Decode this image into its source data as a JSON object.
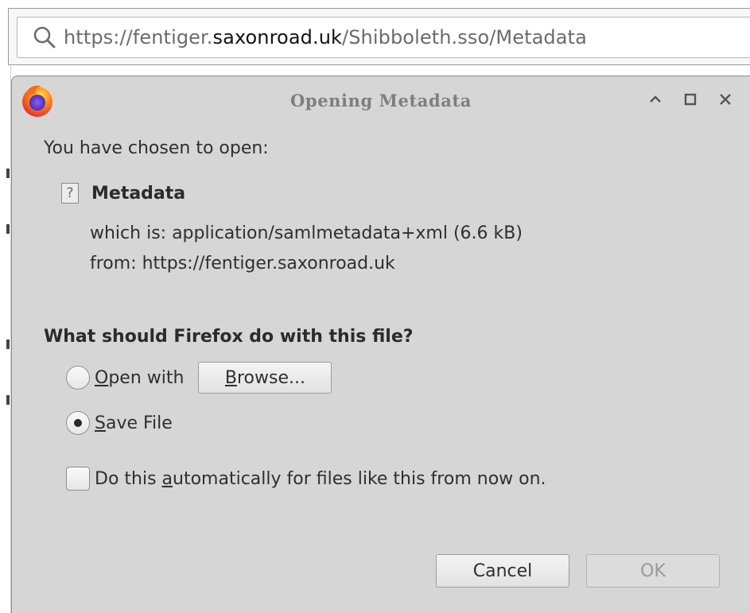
{
  "urlbar": {
    "prefix": "https://fentiger.",
    "domain": "saxonroad.uk",
    "path": "/Shibboleth.sso/Metadata",
    "search_icon": "search-icon"
  },
  "dialog": {
    "title": "Opening Metadata",
    "app_icon": "firefox-logo",
    "controls": [
      "minimize-icon",
      "maximize-icon",
      "close-icon"
    ],
    "intro": "You have chosen to open:",
    "file_icon_glyph": "?",
    "file_name": "Metadata",
    "which_is_label": "which is:",
    "which_is_value": "application/samlmetadata+xml (6.6 kB)",
    "from_label": "from:",
    "from_value": "https://fentiger.saxonroad.uk",
    "question": "What should Firefox do with this file?",
    "open_with_accel": "O",
    "open_with_rest": "pen with",
    "browse_accel": "B",
    "browse_rest": "rowse...",
    "save_file_accel": "S",
    "save_file_rest": "ave File",
    "selected_option": "save_file",
    "auto_pre": "Do this ",
    "auto_accel": "a",
    "auto_post": "utomatically for files like this from now on.",
    "auto_checked": false,
    "cancel_label": "Cancel",
    "ok_label": "OK",
    "ok_enabled": false
  },
  "colors": {
    "dialog_bg": "#d6d6d6",
    "title_text": "#7e7e7e",
    "disabled_text": "#9a9a9a"
  }
}
